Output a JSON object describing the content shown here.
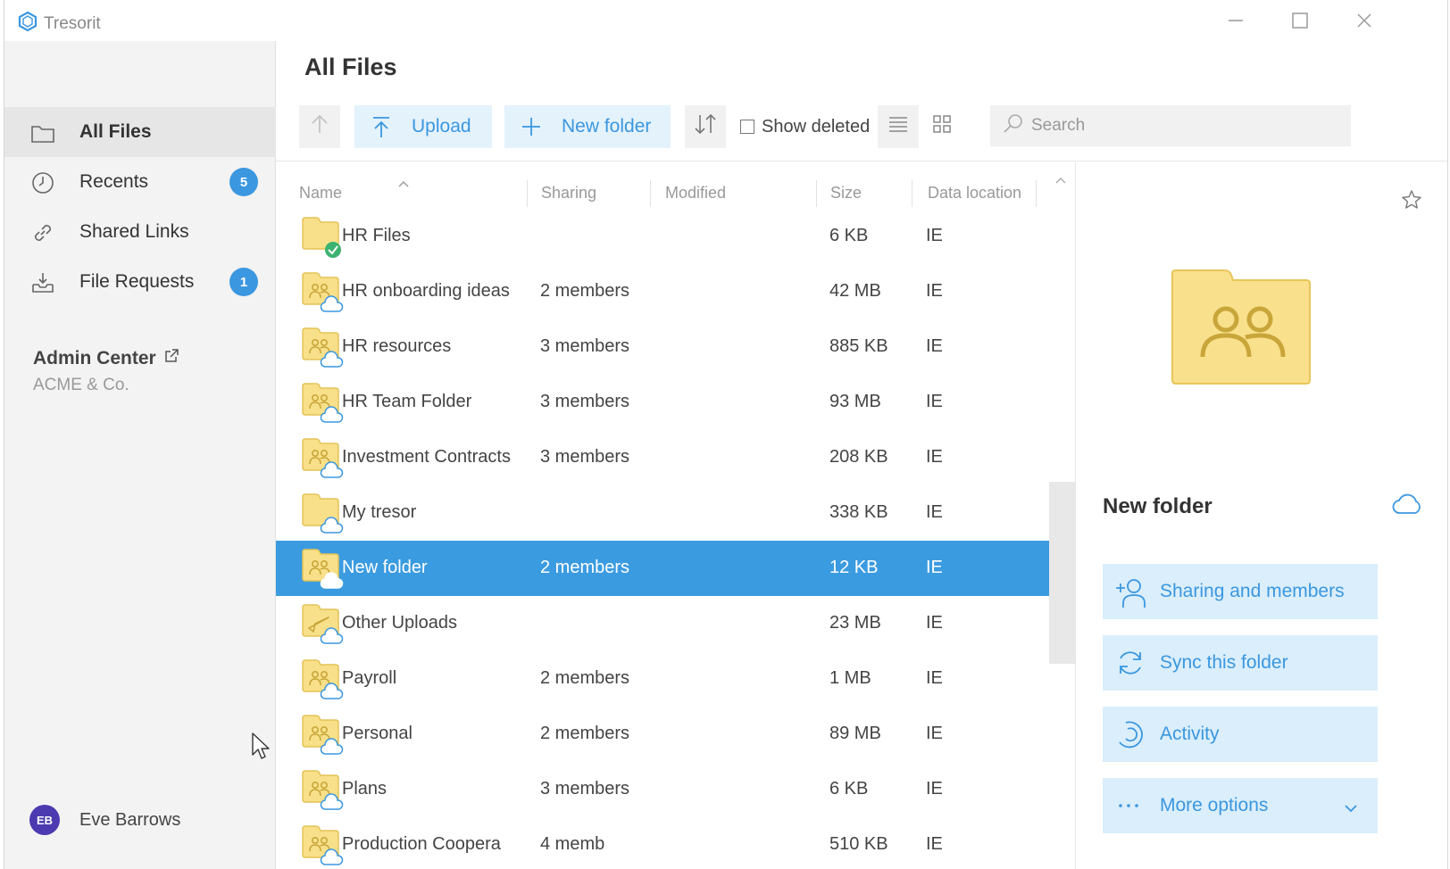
{
  "app": {
    "title": "Tresorit"
  },
  "sidebar": {
    "items": [
      {
        "label": "All Files",
        "icon": "folder-icon",
        "active": true
      },
      {
        "label": "Recents",
        "icon": "clock-icon",
        "badge": "5"
      },
      {
        "label": "Shared Links",
        "icon": "link-icon"
      },
      {
        "label": "File Requests",
        "icon": "inbox-icon",
        "badge": "1"
      }
    ],
    "admin": {
      "title": "Admin Center",
      "org": "ACME & Co."
    },
    "user": {
      "initials": "EB",
      "name": "Eve Barrows"
    }
  },
  "main": {
    "title": "All Files",
    "toolbar": {
      "upload": "Upload",
      "new_folder": "New folder",
      "show_deleted": "Show deleted",
      "search_placeholder": "Search"
    },
    "columns": {
      "name": "Name",
      "sharing": "Sharing",
      "modified": "Modified",
      "size": "Size",
      "location": "Data location"
    },
    "rows": [
      {
        "name": "HR Files",
        "sharing": "",
        "size": "6 KB",
        "location": "IE",
        "type": "synced"
      },
      {
        "name": "HR onboarding ideas",
        "sharing": "2 members",
        "size": "42 MB",
        "location": "IE",
        "type": "shared"
      },
      {
        "name": "HR resources",
        "sharing": "3 members",
        "size": "885 KB",
        "location": "IE",
        "type": "shared"
      },
      {
        "name": "HR Team Folder",
        "sharing": "3 members",
        "size": "93 MB",
        "location": "IE",
        "type": "shared"
      },
      {
        "name": "Investment Contracts",
        "sharing": "3 members",
        "size": "208 KB",
        "location": "IE",
        "type": "shared"
      },
      {
        "name": "My tresor",
        "sharing": "",
        "size": "338 KB",
        "location": "IE",
        "type": "plain"
      },
      {
        "name": "New folder",
        "sharing": "2 members",
        "size": "12 KB",
        "location": "IE",
        "type": "shared",
        "selected": true
      },
      {
        "name": "Other Uploads",
        "sharing": "",
        "size": "23 MB",
        "location": "IE",
        "type": "upload"
      },
      {
        "name": "Payroll",
        "sharing": "2 members",
        "size": "1 MB",
        "location": "IE",
        "type": "shared"
      },
      {
        "name": "Personal",
        "sharing": "2 members",
        "size": "89 MB",
        "location": "IE",
        "type": "shared"
      },
      {
        "name": "Plans",
        "sharing": "3 members",
        "size": "6 KB",
        "location": "IE",
        "type": "shared"
      },
      {
        "name": "Production Coopera",
        "sharing": "4 memb",
        "size": "510 KB",
        "location": "IE",
        "type": "shared"
      }
    ]
  },
  "details": {
    "name": "New folder",
    "actions": {
      "sharing": "Sharing and members",
      "sync": "Sync this folder",
      "activity": "Activity",
      "more": "More options"
    }
  },
  "colors": {
    "accent": "#3b97e0",
    "selected_row": "#3b9be0",
    "folder": "#f8e08a",
    "badge": "#3b97e0",
    "avatar": "#4b3ab0"
  }
}
